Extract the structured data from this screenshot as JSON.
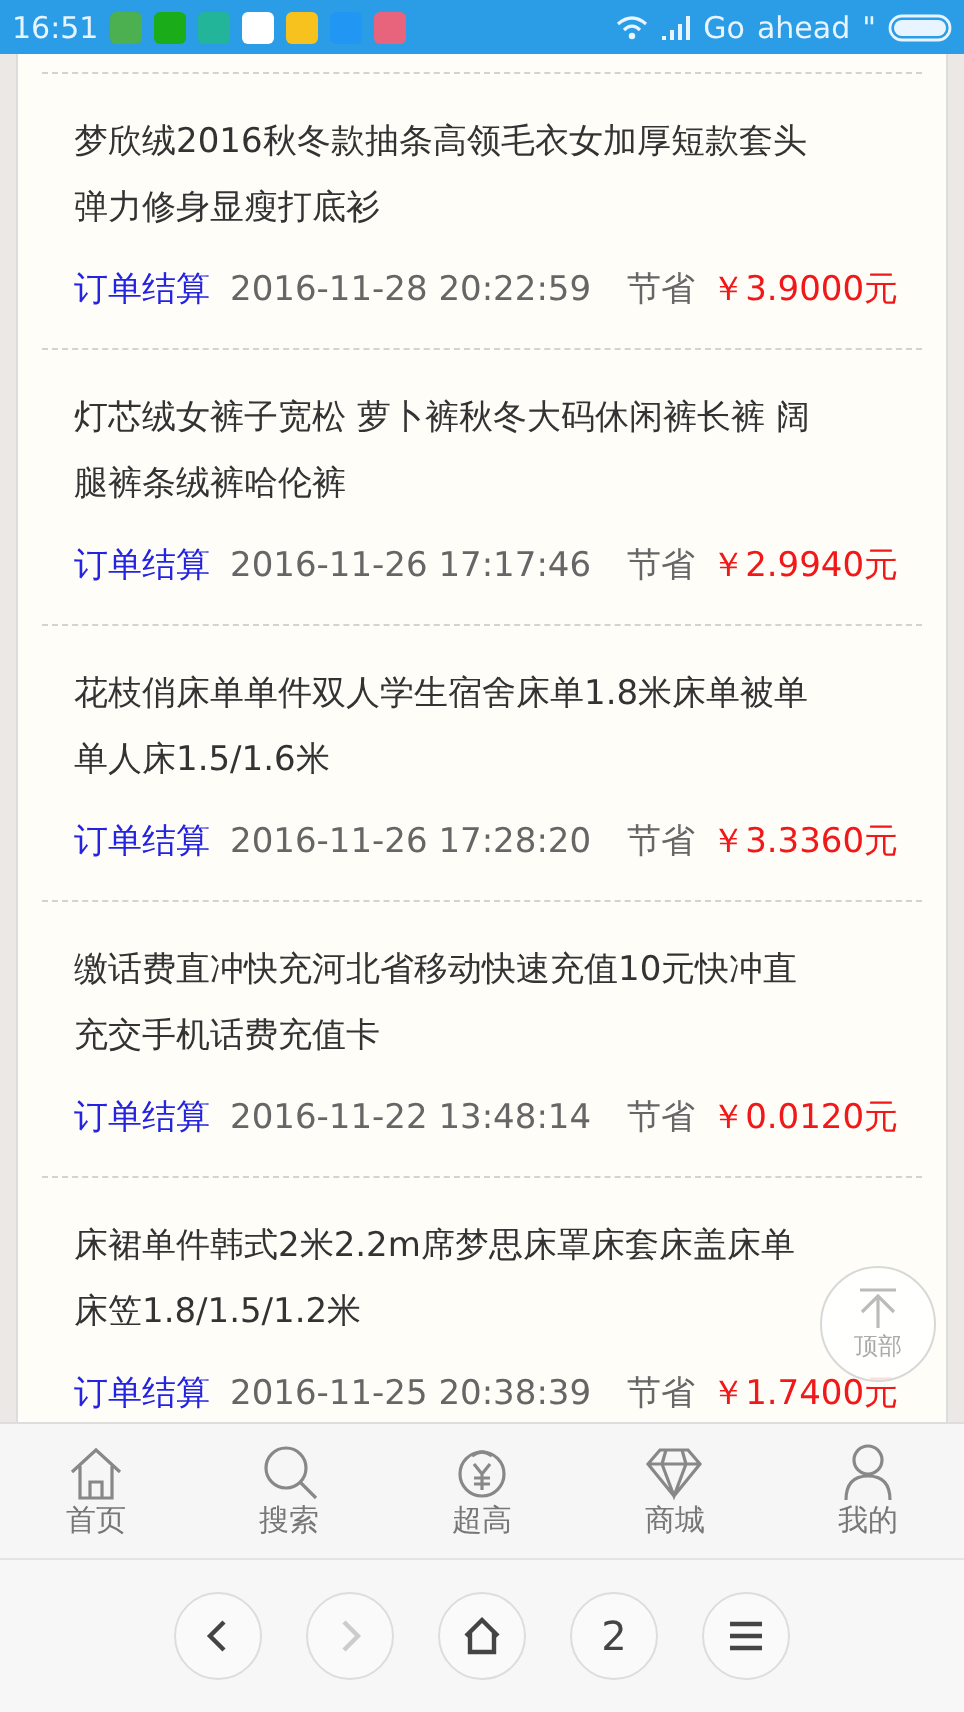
{
  "status_bar": {
    "time": "16:51",
    "apps": [
      {
        "color": "#4caf50"
      },
      {
        "color": "#1aad19"
      },
      {
        "color": "#22b59a"
      },
      {
        "color": "#ffffff"
      },
      {
        "color": "#f7c21e"
      },
      {
        "color": "#2196f3"
      },
      {
        "color": "#e8647c"
      }
    ],
    "carrier": [
      "Go",
      "ahead",
      "\""
    ]
  },
  "orders": [
    {
      "title": "梦欣绒2016秋冬款抽条高领毛衣女加厚短款套头弹力修身显瘦打底衫",
      "action": "订单结算",
      "date": "2016-11-28 20:22:59",
      "save_label": "节省",
      "amount": "￥3.9000元"
    },
    {
      "title": "灯芯绒女裤子宽松 萝卜裤秋冬大码休闲裤长裤 阔腿裤条绒裤哈伦裤",
      "action": "订单结算",
      "date": "2016-11-26 17:17:46",
      "save_label": "节省",
      "amount": "￥2.9940元"
    },
    {
      "title": "花枝俏床单单件双人学生宿舍床单1.8米床单被单单人床1.5/1.6米",
      "action": "订单结算",
      "date": "2016-11-26 17:28:20",
      "save_label": "节省",
      "amount": "￥3.3360元"
    },
    {
      "title": "缴话费直冲快充河北省移动快速充值10元快冲直充交手机话费充值卡",
      "action": "订单结算",
      "date": "2016-11-22 13:48:14",
      "save_label": "节省",
      "amount": "￥0.0120元"
    },
    {
      "title": "床裙单件韩式2米2.2m席梦思床罩床套床盖床单床笠1.8/1.5/1.2米",
      "action": "订单结算",
      "date": "2016-11-25 20:38:39",
      "save_label": "节省",
      "amount": "￥1.7400元"
    }
  ],
  "back_to_top": "顶部",
  "nav": [
    {
      "kind": "home",
      "label": "首页"
    },
    {
      "kind": "search",
      "label": "搜索"
    },
    {
      "kind": "coin",
      "label": "超高"
    },
    {
      "kind": "diamond",
      "label": "商城"
    },
    {
      "kind": "user",
      "label": "我的"
    }
  ],
  "browser": [
    {
      "kind": "back",
      "disabled": false
    },
    {
      "kind": "forward",
      "disabled": true
    },
    {
      "kind": "home",
      "disabled": false
    },
    {
      "kind": "tabs",
      "label": "2",
      "disabled": false
    },
    {
      "kind": "menu",
      "disabled": false
    }
  ]
}
